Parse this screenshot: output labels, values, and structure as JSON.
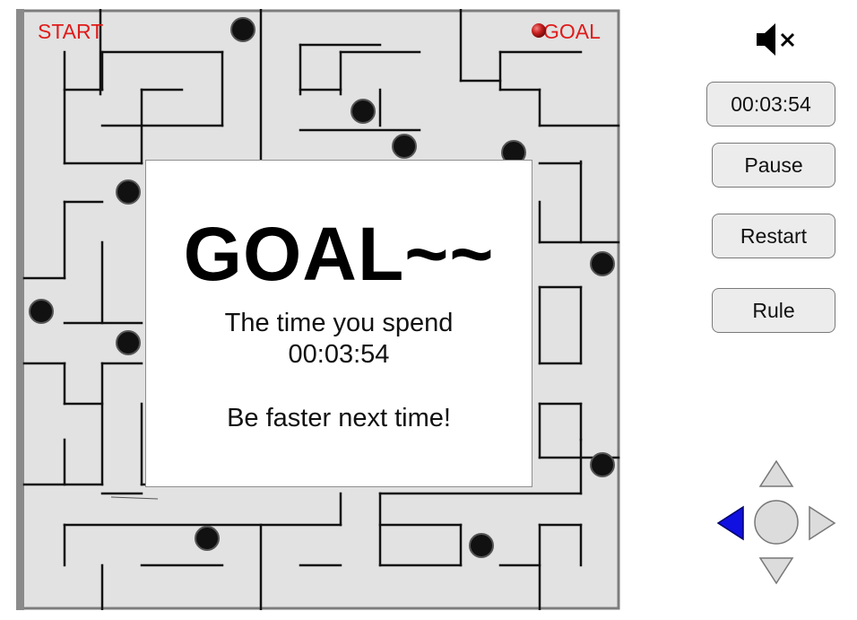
{
  "maze": {
    "start_label": "START",
    "goal_label": "GOAL",
    "player_ball_color": "#c81e1e",
    "obstacle_ball_color": "#111111",
    "wall_color": "#111111",
    "floor_color": "#e2e2e2"
  },
  "dialog": {
    "heading": "GOAL~~",
    "time_label": "The time you spend",
    "time_value": "00:03:54",
    "message": "Be faster next time!"
  },
  "controls": {
    "mute_icon": "speaker-muted-icon",
    "timer": "00:03:54",
    "pause_label": "Pause",
    "restart_label": "Restart",
    "rule_label": "Rule"
  },
  "dpad": {
    "active_direction": "left",
    "active_color": "#1010e0",
    "inactive_color": "#dcdcdc"
  }
}
